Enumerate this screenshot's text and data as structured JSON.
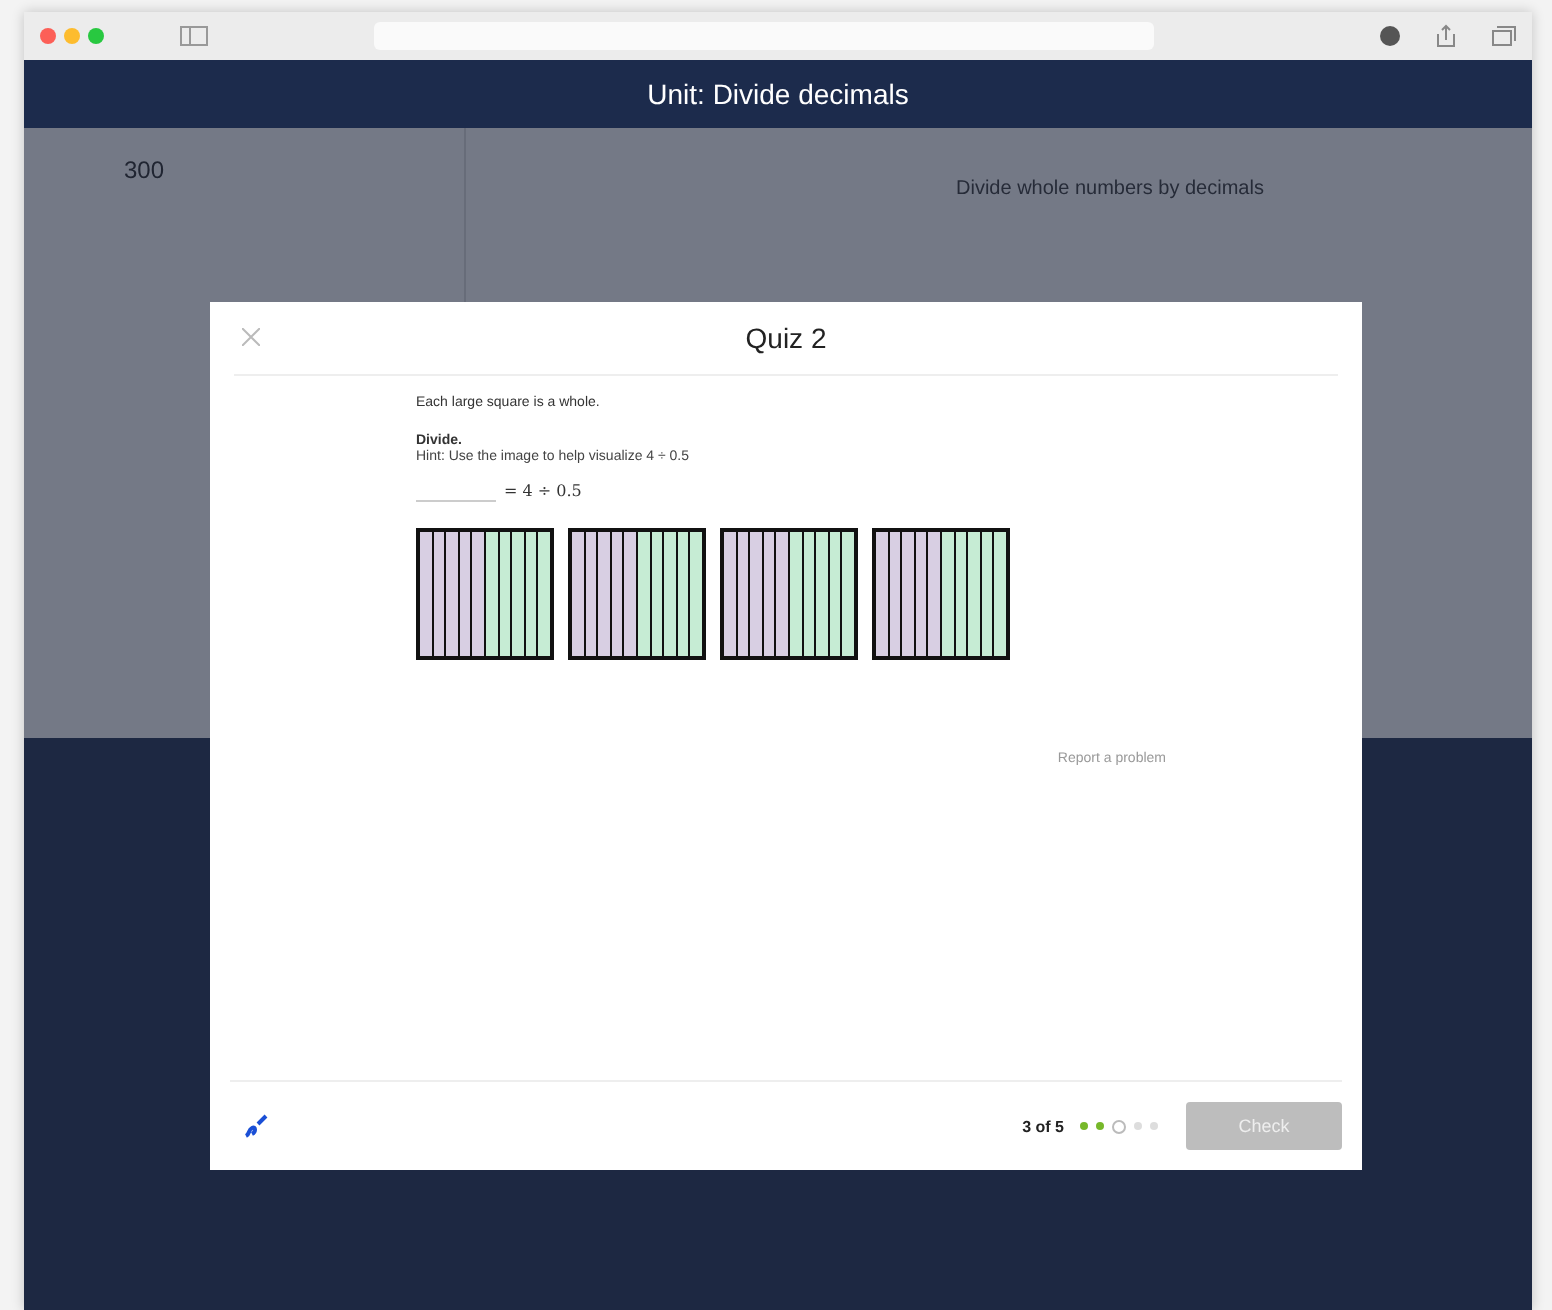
{
  "header": {
    "title": "Unit: Divide decimals"
  },
  "background": {
    "score": "300",
    "lesson": "Divide whole numbers by decimals"
  },
  "modal": {
    "title": "Quiz 2",
    "intro": "Each large square is a whole.",
    "instruction": "Divide.",
    "hint": "Hint: Use the image to help visualize 4 ÷ 0.5",
    "equation": "= 4 ÷ 0.5",
    "squares": [
      {
        "parts": [
          {
            "color": "#d8cfe3"
          },
          {
            "color": "#d8cfe3"
          },
          {
            "color": "#d8cfe3"
          },
          {
            "color": "#d8cfe3"
          },
          {
            "color": "#d8cfe3"
          },
          {
            "color": "#c6ecd4"
          },
          {
            "color": "#c6ecd4"
          },
          {
            "color": "#c6ecd4"
          },
          {
            "color": "#c6ecd4"
          },
          {
            "color": "#c6ecd4"
          }
        ]
      },
      {
        "parts": [
          {
            "color": "#d8cfe3"
          },
          {
            "color": "#d8cfe3"
          },
          {
            "color": "#d8cfe3"
          },
          {
            "color": "#d8cfe3"
          },
          {
            "color": "#d8cfe3"
          },
          {
            "color": "#c6ecd4"
          },
          {
            "color": "#c6ecd4"
          },
          {
            "color": "#c6ecd4"
          },
          {
            "color": "#c6ecd4"
          },
          {
            "color": "#c6ecd4"
          }
        ]
      },
      {
        "parts": [
          {
            "color": "#d8cfe3"
          },
          {
            "color": "#d8cfe3"
          },
          {
            "color": "#d8cfe3"
          },
          {
            "color": "#d8cfe3"
          },
          {
            "color": "#d8cfe3"
          },
          {
            "color": "#c6ecd4"
          },
          {
            "color": "#c6ecd4"
          },
          {
            "color": "#c6ecd4"
          },
          {
            "color": "#c6ecd4"
          },
          {
            "color": "#c6ecd4"
          }
        ]
      },
      {
        "parts": [
          {
            "color": "#d8cfe3"
          },
          {
            "color": "#d8cfe3"
          },
          {
            "color": "#d8cfe3"
          },
          {
            "color": "#d8cfe3"
          },
          {
            "color": "#d8cfe3"
          },
          {
            "color": "#c6ecd4"
          },
          {
            "color": "#c6ecd4"
          },
          {
            "color": "#c6ecd4"
          },
          {
            "color": "#c6ecd4"
          },
          {
            "color": "#c6ecd4"
          }
        ]
      }
    ],
    "report_link": "Report a problem",
    "progress": "3 of 5",
    "steps": [
      {
        "kind": "done"
      },
      {
        "kind": "done"
      },
      {
        "kind": "current"
      },
      {
        "kind": "todo"
      },
      {
        "kind": "todo"
      }
    ],
    "check_button": {
      "label": "Check",
      "disabled": true
    }
  }
}
